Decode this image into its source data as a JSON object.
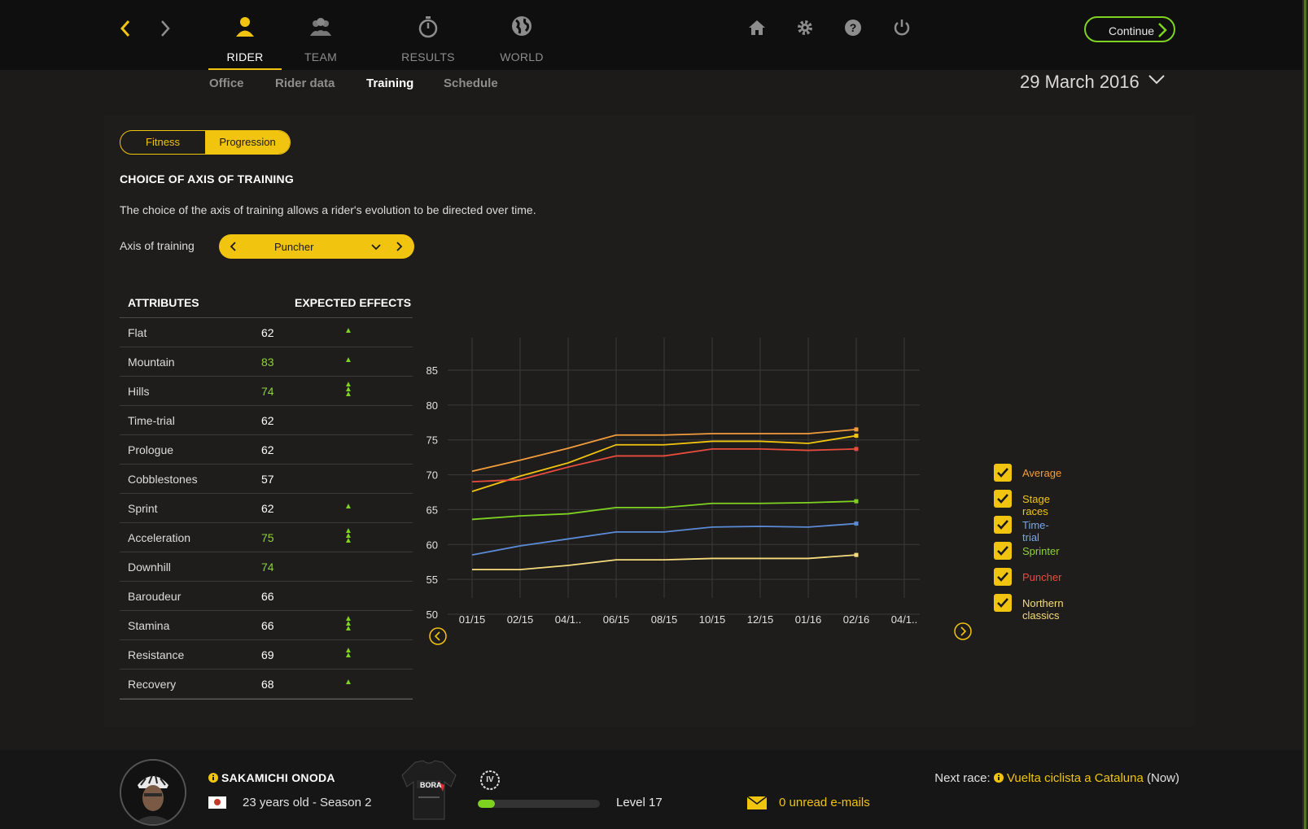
{
  "nav": {
    "tabs": [
      {
        "label": "RIDER",
        "icon": "rider-icon"
      },
      {
        "label": "TEAM",
        "icon": "team-icon"
      },
      {
        "label": "RESULTS",
        "icon": "stopwatch-icon"
      },
      {
        "label": "WORLD",
        "icon": "globe-icon"
      }
    ],
    "active_tab": "RIDER",
    "continue_label": "Continue",
    "subtabs": [
      "Office",
      "Rider data",
      "Training",
      "Schedule"
    ],
    "active_subtab": "Training",
    "date": "29 March 2016"
  },
  "colors": {
    "accent": "#f1c40f",
    "green": "#7ed321",
    "background": "#1c1b1a"
  },
  "training": {
    "toggle": {
      "fitness": "Fitness",
      "progression": "Progression",
      "active": "Progression"
    },
    "title": "CHOICE OF AXIS OF TRAINING",
    "description": "The choice of the axis of training allows a rider's evolution to be directed over time.",
    "axis_label": "Axis of training",
    "axis_value": "Puncher"
  },
  "attributes": {
    "header_attr": "ATTRIBUTES",
    "header_effects": "EXPECTED EFFECTS",
    "rows": [
      {
        "name": "Flat",
        "value": "62",
        "effect": 1,
        "highlight": false
      },
      {
        "name": "Mountain",
        "value": "83",
        "effect": 1,
        "highlight": true
      },
      {
        "name": "Hills",
        "value": "74",
        "effect": 3,
        "highlight": true
      },
      {
        "name": "Time-trial",
        "value": "62",
        "effect": 0,
        "highlight": false
      },
      {
        "name": "Prologue",
        "value": "62",
        "effect": 0,
        "highlight": false
      },
      {
        "name": "Cobblestones",
        "value": "57",
        "effect": 0,
        "highlight": false
      },
      {
        "name": "Sprint",
        "value": "62",
        "effect": 1,
        "highlight": false
      },
      {
        "name": "Acceleration",
        "value": "75",
        "effect": 3,
        "highlight": true
      },
      {
        "name": "Downhill",
        "value": "74",
        "effect": 0,
        "highlight": true
      },
      {
        "name": "Baroudeur",
        "value": "66",
        "effect": 0,
        "highlight": false
      },
      {
        "name": "Stamina",
        "value": "66",
        "effect": 3,
        "highlight": false
      },
      {
        "name": "Resistance",
        "value": "69",
        "effect": 2,
        "highlight": false
      },
      {
        "name": "Recovery",
        "value": "68",
        "effect": 1,
        "highlight": false
      }
    ]
  },
  "chart_data": {
    "type": "line",
    "x": [
      "01/15",
      "02/15",
      "04/1..",
      "06/15",
      "08/15",
      "10/15",
      "12/15",
      "01/16",
      "02/16",
      "04/1.."
    ],
    "ylim": [
      50,
      85
    ],
    "yticks": [
      50,
      55,
      60,
      65,
      70,
      75,
      80,
      85
    ],
    "grid": true,
    "legend_position": "right",
    "series": [
      {
        "name": "Average",
        "color": "#f39c3c",
        "values": [
          70.5,
          72.1,
          73.8,
          75.7,
          75.7,
          75.9,
          75.9,
          75.9,
          76.5
        ]
      },
      {
        "name": "Stage races",
        "color": "#f1c40f",
        "values": [
          67.6,
          69.8,
          71.7,
          74.3,
          74.3,
          74.8,
          74.8,
          74.5,
          75.6
        ]
      },
      {
        "name": "Time-trial",
        "color": "#5b8bd6",
        "values": [
          58.5,
          59.8,
          60.8,
          61.8,
          61.8,
          62.5,
          62.6,
          62.5,
          63.0
        ]
      },
      {
        "name": "Sprinter",
        "color": "#7ed321",
        "values": [
          63.6,
          64.1,
          64.4,
          65.3,
          65.3,
          65.9,
          65.9,
          66.0,
          66.2
        ]
      },
      {
        "name": "Puncher",
        "color": "#e84c3d",
        "values": [
          69.0,
          69.3,
          71.1,
          72.7,
          72.7,
          73.7,
          73.7,
          73.5,
          73.7
        ]
      },
      {
        "name": "Northern classics",
        "color": "#f7dc7e",
        "values": [
          56.4,
          56.4,
          57.0,
          57.8,
          57.8,
          58.0,
          58.0,
          58.0,
          58.5
        ]
      }
    ]
  },
  "legend": [
    {
      "label": "Average",
      "color": "#f39c3c"
    },
    {
      "label": "Stage races",
      "color": "#f1c40f"
    },
    {
      "label": "Time-trial",
      "color": "#7aa7e8"
    },
    {
      "label": "Sprinter",
      "color": "#8bd33a"
    },
    {
      "label": "Puncher",
      "color": "#e84c3d"
    },
    {
      "label": "Northern classics",
      "color": "#f7dc7e"
    }
  ],
  "footer": {
    "rider_name": "SAKAMICHI ONODA",
    "rider_info": "23 years old - Season 2",
    "level_badge": "IV",
    "level_progress": 0.14,
    "level": "Level 17",
    "mail": "0 unread e-mails",
    "next_race_label": "Next race:",
    "next_race": "Vuelta ciclista a Cataluna",
    "next_race_suffix": "(Now)",
    "jersey_text": "BORA"
  }
}
